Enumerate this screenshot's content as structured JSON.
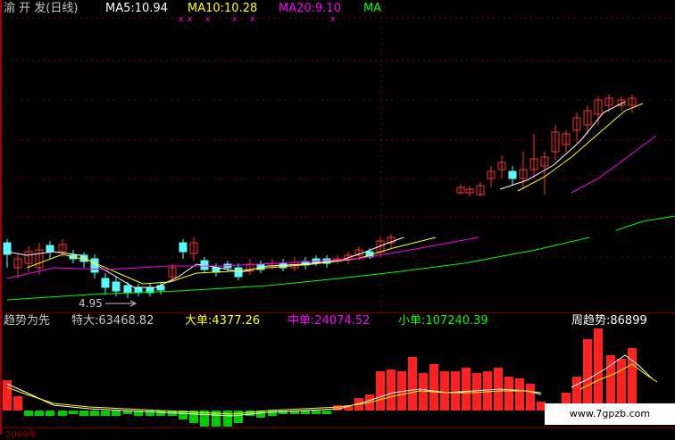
{
  "price_panel": {
    "stock_name": "渝 开 发(日线)",
    "ma5_text": "MA5:10.94",
    "ma10_text": "MA10:10.28",
    "ma20_text": "MA20:9.10",
    "extra_text": "MA",
    "low_marker": "4.95",
    "colors": {
      "ma5": "#ffffff",
      "ma10": "#ffff00",
      "ma20": "#ff00ff",
      "ma60": "#00ff00",
      "up": "#ff3030",
      "down": "#54fcfc"
    }
  },
  "indicator_panel": {
    "title": "趋势为先",
    "tedai_text": "特大:63468.82",
    "dadan_text": "大单:4377.26",
    "zhongdan_text": "中单:24074.52",
    "xiaodan_text": "小单:107240.39",
    "zhouqushi_text": "周趋势:86899",
    "colors": {
      "up": "#ff2020",
      "down": "#00cc00"
    }
  },
  "bottom_axis": {
    "left_label": "2009年"
  },
  "watermark": "www.7gpzb.com"
}
